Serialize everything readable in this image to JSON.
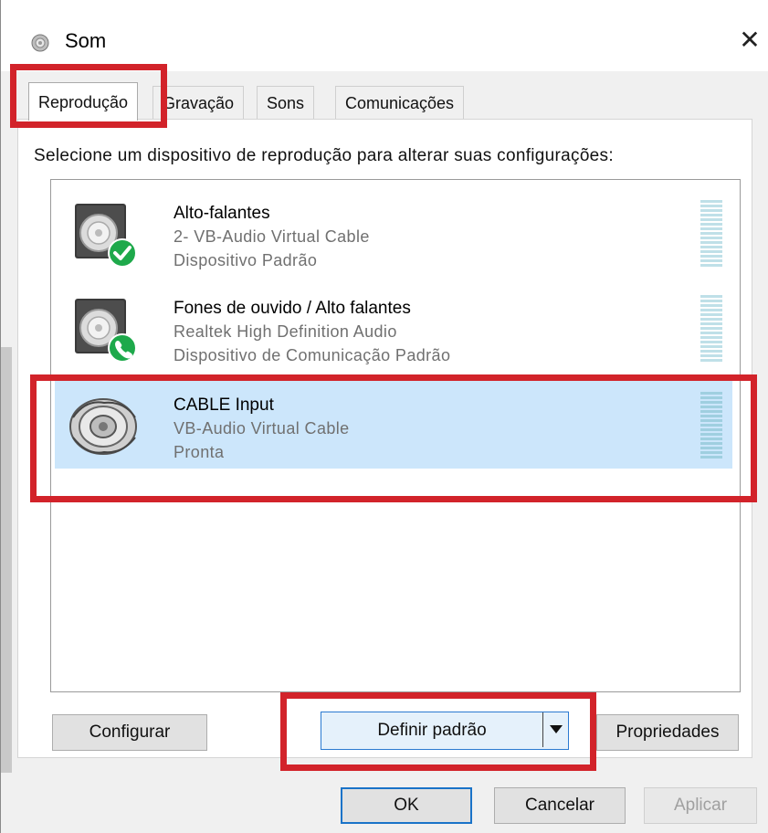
{
  "window": {
    "title": "Som",
    "close_glyph": "✕"
  },
  "tabs": [
    {
      "label": "Reprodução",
      "active": true
    },
    {
      "label": "Gravação",
      "active": false
    },
    {
      "label": "Sons",
      "active": false
    },
    {
      "label": "Comunicações",
      "active": false
    }
  ],
  "instructions": "Selecione um dispositivo de reprodução para alterar suas configurações:",
  "devices": [
    {
      "name": "Alto-falantes",
      "line2": "2- VB-Audio Virtual Cable",
      "line3": "Dispositivo Padrão",
      "badge_icon": "check-badge-icon",
      "selected": false
    },
    {
      "name": "Fones de ouvido / Alto falantes",
      "line2": "Realtek High Definition Audio",
      "line3": "Dispositivo de Comunicação Padrão",
      "badge_icon": "phone-badge-icon",
      "selected": false
    },
    {
      "name": "CABLE Input",
      "line2": "VB-Audio Virtual Cable",
      "line3": "Pronta",
      "badge_icon": "cable-device-icon",
      "selected": true
    }
  ],
  "buttons": {
    "configure": "Configurar",
    "set_default": "Definir padrão",
    "properties": "Propriedades",
    "ok": "OK",
    "cancel": "Cancelar",
    "apply": "Aplicar"
  },
  "colors": {
    "highlight": "#d2232a",
    "selected_row": "#cce6fb",
    "badge_green": "#1ea94b",
    "default_button_border": "#1a73c8"
  }
}
